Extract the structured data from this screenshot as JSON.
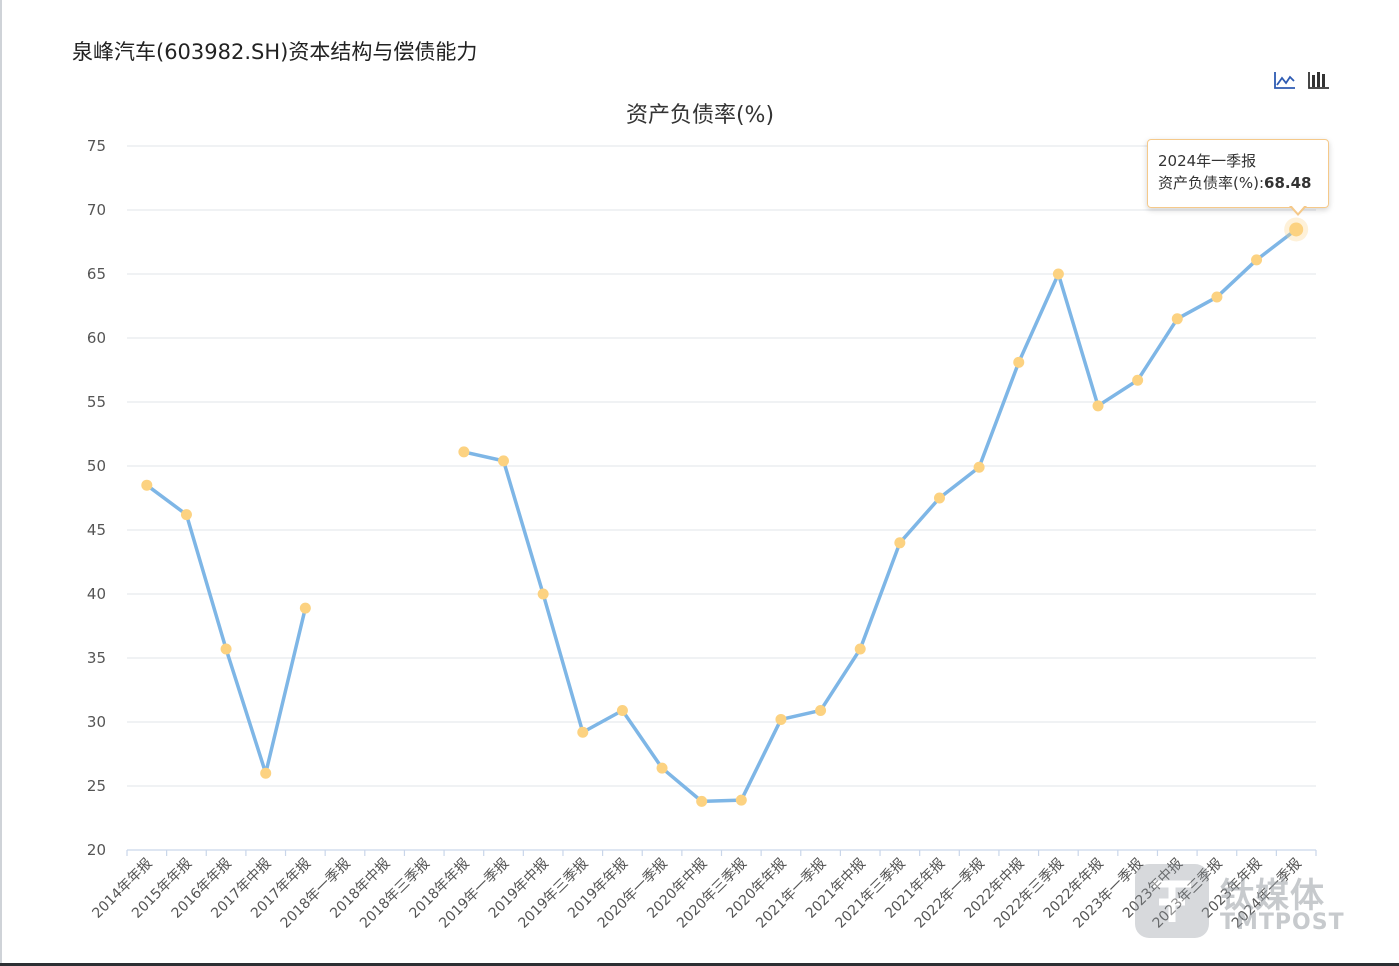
{
  "page": {
    "title": "泉峰汽车(603982.SH)资本结构与偿债能力"
  },
  "toolbox": [
    {
      "name": "line-chart-icon"
    },
    {
      "name": "bar-chart-icon"
    }
  ],
  "tooltip": {
    "period": "2024年一季报",
    "label": "资产负债率(%):",
    "value": "68.48"
  },
  "watermark": {
    "text": "钛媒体",
    "sub": "TMTPOST"
  },
  "colors": {
    "line": "#7eb6e6",
    "point": "#fcd281",
    "grid": "#e6e9ed",
    "axis": "#c9d6ea"
  },
  "chart_data": {
    "type": "line",
    "title": "资产负债率(%)",
    "ylim": [
      20,
      75
    ],
    "yticks": [
      20,
      25,
      30,
      35,
      40,
      45,
      50,
      55,
      60,
      65,
      70,
      75
    ],
    "grid": true,
    "categories": [
      "2014年年报",
      "2015年年报",
      "2016年年报",
      "2017年中报",
      "2017年年报",
      "2018年一季报",
      "2018年中报",
      "2018年三季报",
      "2018年年报",
      "2019年一季报",
      "2019年中报",
      "2019年三季报",
      "2019年年报",
      "2020年一季报",
      "2020年中报",
      "2020年三季报",
      "2020年年报",
      "2021年一季报",
      "2021年中报",
      "2021年三季报",
      "2021年年报",
      "2022年一季报",
      "2022年中报",
      "2022年三季报",
      "2022年年报",
      "2023年一季报",
      "2023年中报",
      "2023年三季报",
      "2023年年报",
      "2024年一季报"
    ],
    "series": [
      {
        "values": [
          48.5,
          46.2,
          35.7,
          26.0,
          38.9,
          null,
          null,
          null,
          51.1,
          50.4,
          40.0,
          29.2,
          30.9,
          26.4,
          23.8,
          23.9,
          30.2,
          30.9,
          35.7,
          44.0,
          47.5,
          49.9,
          58.1,
          65.0,
          54.7,
          56.7,
          61.5,
          63.2,
          66.1,
          68.48
        ]
      }
    ]
  }
}
